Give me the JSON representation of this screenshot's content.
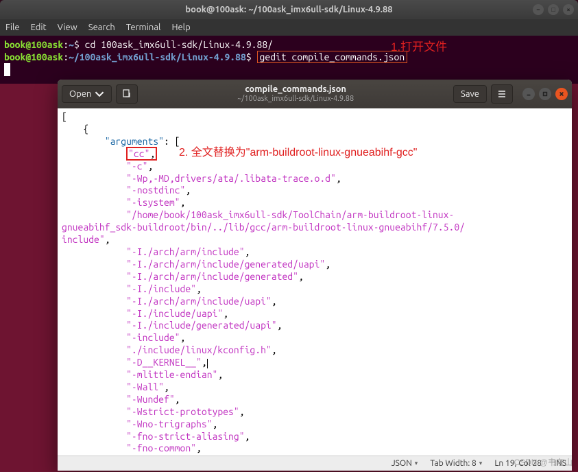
{
  "terminal": {
    "title": "book@100ask: ~/100ask_imx6ull-sdk/Linux-4.9.88",
    "menu": [
      "File",
      "Edit",
      "View",
      "Search",
      "Terminal",
      "Help"
    ],
    "line1_user": "book@100ask",
    "line1_sep": ":",
    "line1_path": "~",
    "line1_dollar": "$ ",
    "line1_cmd": "cd 100ask_imx6ull-sdk/Linux-4.9.88/",
    "line2_user": "book@100ask",
    "line2_sep": ":",
    "line2_path": "~/100ask_imx6ull-sdk/Linux-4.9.88",
    "line2_dollar": "$ ",
    "line2_cmd": "gedit compile_commands.json"
  },
  "anno1": "1.打开文件",
  "anno2": "2. 全文替换为\"arm-buildroot-linux-gnueabihf-gcc\"",
  "gedit": {
    "open": "Open",
    "save": "Save",
    "title": "compile_commands.json",
    "subtitle": "~/100ask_imx6ull-sdk/Linux-4.9.88",
    "status_lang": "JSON",
    "status_tab": "Tab Width: 8",
    "status_pos": "Ln 19, Col 28",
    "status_ins": "INS"
  },
  "code": {
    "l1": "[",
    "l2": "    {",
    "l3_key": "\"arguments\"",
    "l3_after": ": [",
    "cc": "\"cc\"",
    "comma": ",",
    "c": "\"-c\"",
    "wp": "\"-Wp,-MD,drivers/ata/.libata-trace.o.d\"",
    "nostdinc": "\"-nostdinc\"",
    "isystem": "\"-isystem\"",
    "longpath": "\"/home/book/100ask_imx6ull-sdk/ToolChain/arm-buildroot-linux-gnueabihf_sdk-buildroot/bin/../lib/gcc/arm-buildroot-linux-gnueabihf/7.5.0/include\"",
    "i1": "\"-I./arch/arm/include\"",
    "i2": "\"-I./arch/arm/include/generated/uapi\"",
    "i3": "\"-I./arch/arm/include/generated\"",
    "i4": "\"-I./include\"",
    "i5": "\"-I./arch/arm/include/uapi\"",
    "i6": "\"-I./include/uapi\"",
    "i7": "\"-I./include/generated/uapi\"",
    "inc": "\"-include\"",
    "kconfig": "\"./include/linux/kconfig.h\"",
    "dkernel": "\"-D__KERNEL__\"",
    "mlittle": "\"-mlittle-endian\"",
    "wall": "\"-Wall\"",
    "wundef": "\"-Wundef\"",
    "wstrict": "\"-Wstrict-prototypes\"",
    "wnotri": "\"-Wno-trigraphs\"",
    "fnostrict": "\"-fno-strict-aliasing\"",
    "fnocommon": "\"-fno-common\""
  },
  "watermark": "CSDN @韦东山"
}
